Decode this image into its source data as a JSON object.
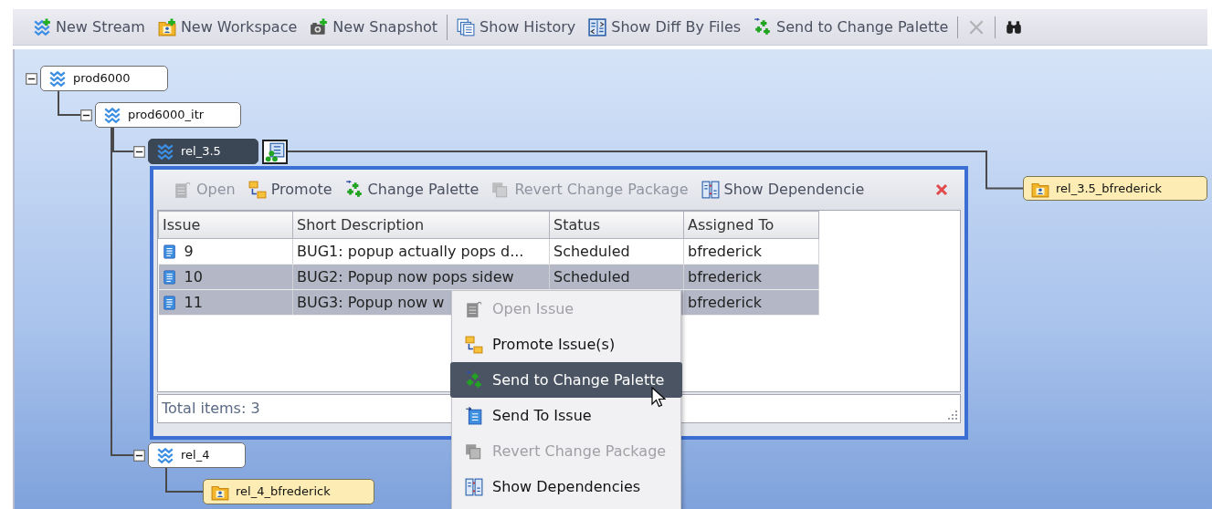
{
  "toolbar": {
    "groups": [
      [
        {
          "label": "New Stream",
          "disabled": false
        },
        {
          "label": "New Workspace",
          "disabled": false
        },
        {
          "label": "New Snapshot",
          "disabled": false
        }
      ],
      [
        {
          "label": "Show History",
          "disabled": false
        },
        {
          "label": "Show Diff By Files",
          "disabled": false
        },
        {
          "label": "Send to Change Palette",
          "disabled": false
        }
      ],
      [
        {
          "disabled": true
        }
      ],
      [
        {
          "disabled": false
        }
      ]
    ]
  },
  "tree": [
    {
      "label": "prod6000",
      "kind": "stream",
      "expanded": true,
      "selected": false,
      "children": [
        {
          "label": "prod6000_itr",
          "kind": "stream",
          "expanded": true,
          "selected": false,
          "children": [
            {
              "label": "rel_3.5",
              "kind": "stream",
              "expanded": true,
              "selected": true,
              "change_package_badge": true,
              "children": [
                {
                  "label": "rel_3.5_bfrederick",
                  "kind": "workspace",
                  "selected": false
                }
              ]
            },
            {
              "label": "rel_4",
              "kind": "stream",
              "expanded": true,
              "selected": false,
              "change_package_badge": false,
              "children": [
                {
                  "label": "rel_4_bfrederick",
                  "kind": "workspace",
                  "selected": false
                }
              ]
            }
          ]
        }
      ]
    }
  ],
  "issues_popup": {
    "toolbar": [
      {
        "label": "Open",
        "disabled": true
      },
      {
        "label": "Promote",
        "disabled": false
      },
      {
        "label": "Change Palette",
        "disabled": false
      },
      {
        "label": "Revert Change Package",
        "disabled": true
      },
      {
        "label": "Show Dependencie",
        "disabled": false
      }
    ],
    "columns": [
      "Issue",
      "Short Description",
      "Status",
      "Assigned To"
    ],
    "rows": [
      {
        "issue": "9",
        "description": "BUG1: popup actually pops d...",
        "status": "Scheduled",
        "assigned_to": "bfrederick",
        "selected": false
      },
      {
        "issue": "10",
        "description": "BUG2: Popup now pops sidew",
        "status": "Scheduled",
        "assigned_to": "bfrederick",
        "selected": true
      },
      {
        "issue": "11",
        "description": "BUG3: Popup now w",
        "assigned_to": "bfrederick",
        "selected": true
      }
    ],
    "footer": "Total items: 3"
  },
  "context_menu": [
    {
      "label": "Open Issue",
      "disabled": true,
      "selected": false
    },
    {
      "label": "Promote Issue(s)",
      "disabled": false,
      "selected": false
    },
    {
      "label": "Send to Change Palette",
      "disabled": false,
      "selected": true
    },
    {
      "label": "Send To Issue",
      "disabled": false,
      "selected": false
    },
    {
      "label": "Revert Change Package",
      "disabled": true,
      "selected": false
    },
    {
      "label": "Show Dependencies",
      "disabled": false,
      "selected": false
    }
  ]
}
